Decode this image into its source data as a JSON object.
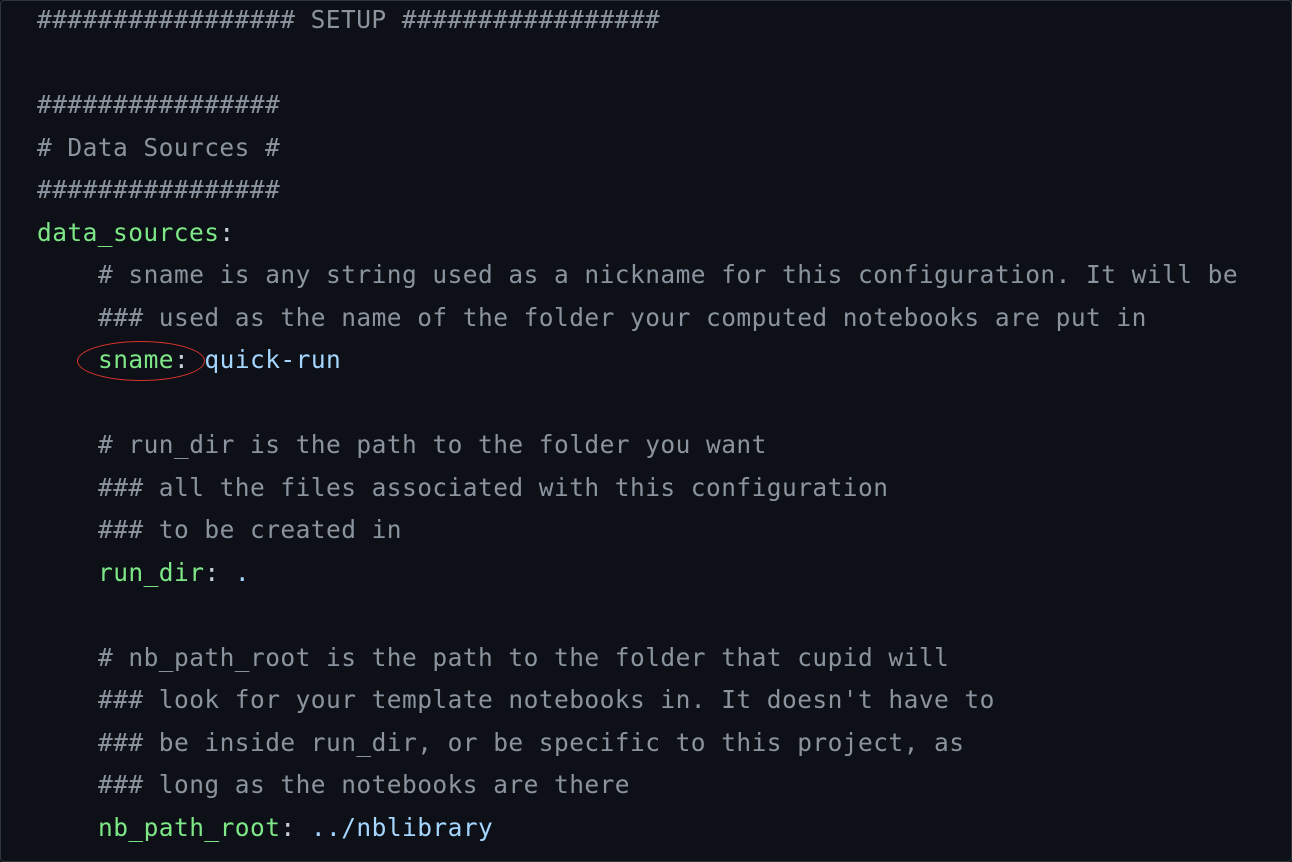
{
  "lines": [
    {
      "comment": "################# SETUP #################"
    },
    {
      "comment": ""
    },
    {
      "comment": "################"
    },
    {
      "comment": "# Data Sources #"
    },
    {
      "comment": "################"
    },
    {
      "key": "data_sources",
      "sep": ":"
    },
    {
      "comment": "# sname is any string used as a nickname for this configuration. It will be"
    },
    {
      "comment": "### used as the name of the folder your computed notebooks are put in"
    },
    {
      "key": "sname",
      "sep": ":",
      "value": "quick-run"
    },
    {
      "comment": "# run_dir is the path to the folder you want"
    },
    {
      "comment": "### all the files associated with this configuration"
    },
    {
      "comment": "### to be created in"
    },
    {
      "key": "run_dir",
      "sep": ":",
      "value": "."
    },
    {
      "comment": "# nb_path_root is the path to the folder that cupid will"
    },
    {
      "comment": "### look for your template notebooks in. It doesn't have to"
    },
    {
      "comment": "### be inside run_dir, or be specific to this project, as"
    },
    {
      "comment": "### long as the notebooks are there"
    },
    {
      "key": "nb_path_root",
      "sep": ":",
      "value": "../nblibrary"
    }
  ],
  "colors": {
    "background": "#0d1117",
    "comment": "#8b949e",
    "key": "#7ee787",
    "value": "#a5d6ff",
    "annotation": "#d9342b"
  }
}
